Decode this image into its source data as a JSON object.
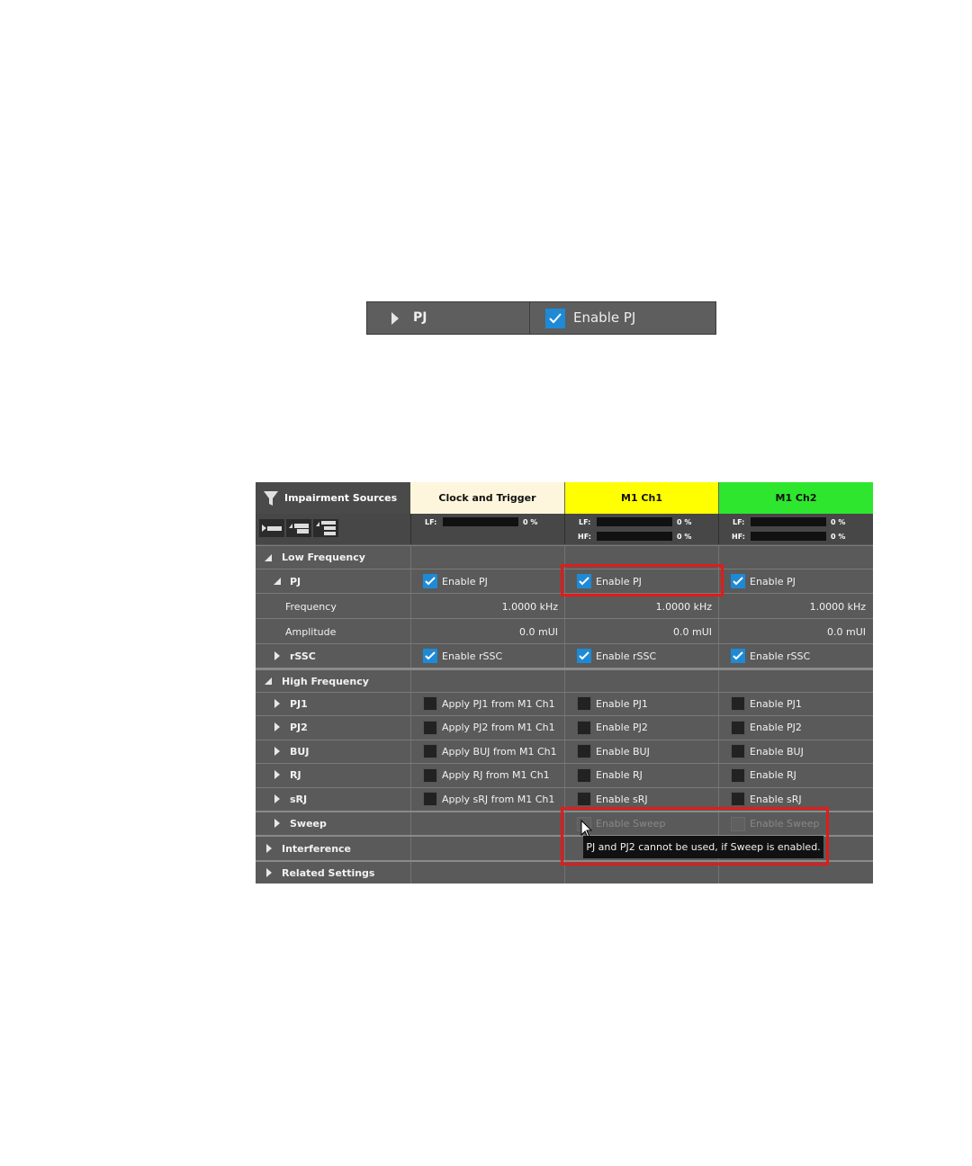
{
  "top_bar": {
    "section_label": "PJ",
    "checkbox_label": "Enable PJ",
    "checked": true
  },
  "panel": {
    "title": "Impairment Sources",
    "columns": [
      {
        "label": "Clock and Trigger",
        "bg": "#fdf6dc"
      },
      {
        "label": "M1 Ch1",
        "bg": "#ffff00"
      },
      {
        "label": "M1 Ch2",
        "bg": "#2ee62e"
      }
    ],
    "meters": {
      "lf_label": "LF:",
      "hf_label": "HF:",
      "c1_lf": "0 %",
      "c2_lf": "0 %",
      "c2_hf": "0 %",
      "c3_lf": "0 %",
      "c3_hf": "0 %"
    },
    "sections": {
      "low_frequency": "Low Frequency",
      "high_frequency": "High Frequency",
      "interference": "Interference",
      "related_settings": "Related Settings"
    },
    "pj": {
      "label": "PJ",
      "c1": "Enable PJ",
      "c2": "Enable PJ",
      "c3": "Enable PJ"
    },
    "frequency": {
      "label": "Frequency",
      "c1": "1.0000 kHz",
      "c2": "1.0000 kHz",
      "c3": "1.0000 kHz"
    },
    "amplitude": {
      "label": "Amplitude",
      "c1": "0.0 mUI",
      "c2": "0.0 mUI",
      "c3": "0.0 mUI"
    },
    "rssc": {
      "label": "rSSC",
      "c1": "Enable rSSC",
      "c2": "Enable rSSC",
      "c3": "Enable rSSC"
    },
    "pj1": {
      "label": "PJ1",
      "c1": "Apply PJ1 from M1 Ch1",
      "c2": "Enable PJ1",
      "c3": "Enable PJ1"
    },
    "pj2": {
      "label": "PJ2",
      "c1": "Apply PJ2 from M1 Ch1",
      "c2": "Enable PJ2",
      "c3": "Enable PJ2"
    },
    "buj": {
      "label": "BUJ",
      "c1": "Apply BUJ from M1 Ch1",
      "c2": "Enable BUJ",
      "c3": "Enable BUJ"
    },
    "rj": {
      "label": "RJ",
      "c1": "Apply RJ from M1 Ch1",
      "c2": "Enable RJ",
      "c3": "Enable RJ"
    },
    "srj": {
      "label": "sRJ",
      "c1": "Apply sRJ from M1 Ch1",
      "c2": "Enable sRJ",
      "c3": "Enable sRJ"
    },
    "sweep": {
      "label": "Sweep",
      "c2": "Enable Sweep",
      "c3": "Enable Sweep"
    },
    "tooltip": "PJ and PJ2 cannot be used, if Sweep is enabled.",
    "highlight_color": "#e21b1b"
  }
}
